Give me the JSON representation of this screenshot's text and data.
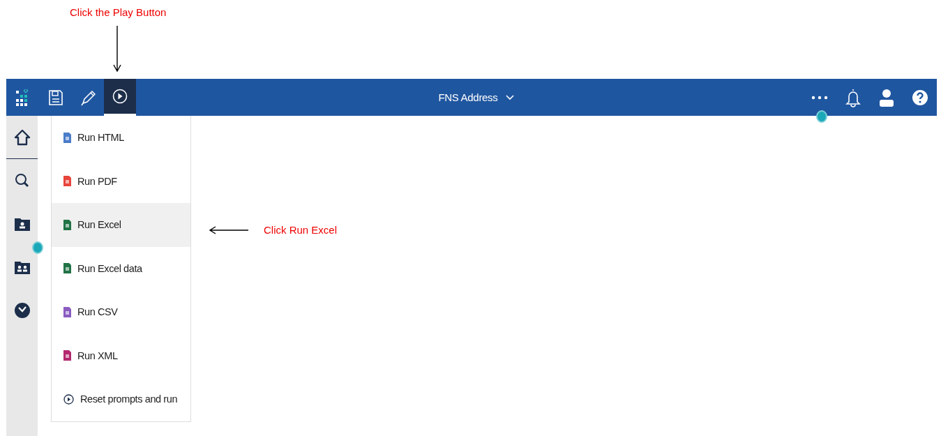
{
  "annotations": [
    {
      "text": "Click the Play Button",
      "kind": "down"
    },
    {
      "text": "Click Run Excel",
      "kind": "left"
    }
  ],
  "header": {
    "title": "FNS Address",
    "play_active": true
  },
  "sidebar": {
    "items": [
      {
        "kind": "home",
        "selected": true
      },
      {
        "kind": "search",
        "selected": false
      },
      {
        "kind": "my-content",
        "selected": false
      },
      {
        "kind": "team-content",
        "selected": false
      },
      {
        "kind": "recent",
        "selected": false
      }
    ]
  },
  "run_menu": {
    "items": [
      {
        "label": "Run HTML",
        "kind": "html",
        "selected": false
      },
      {
        "label": "Run PDF",
        "kind": "pdf",
        "selected": false
      },
      {
        "label": "Run Excel",
        "kind": "excel",
        "selected": true
      },
      {
        "label": "Run Excel data",
        "kind": "excel",
        "selected": false
      },
      {
        "label": "Run CSV",
        "kind": "csv",
        "selected": false
      },
      {
        "label": "Run XML",
        "kind": "xml",
        "selected": false
      },
      {
        "label": "Reset prompts and run",
        "kind": "reset",
        "selected": false
      }
    ]
  }
}
